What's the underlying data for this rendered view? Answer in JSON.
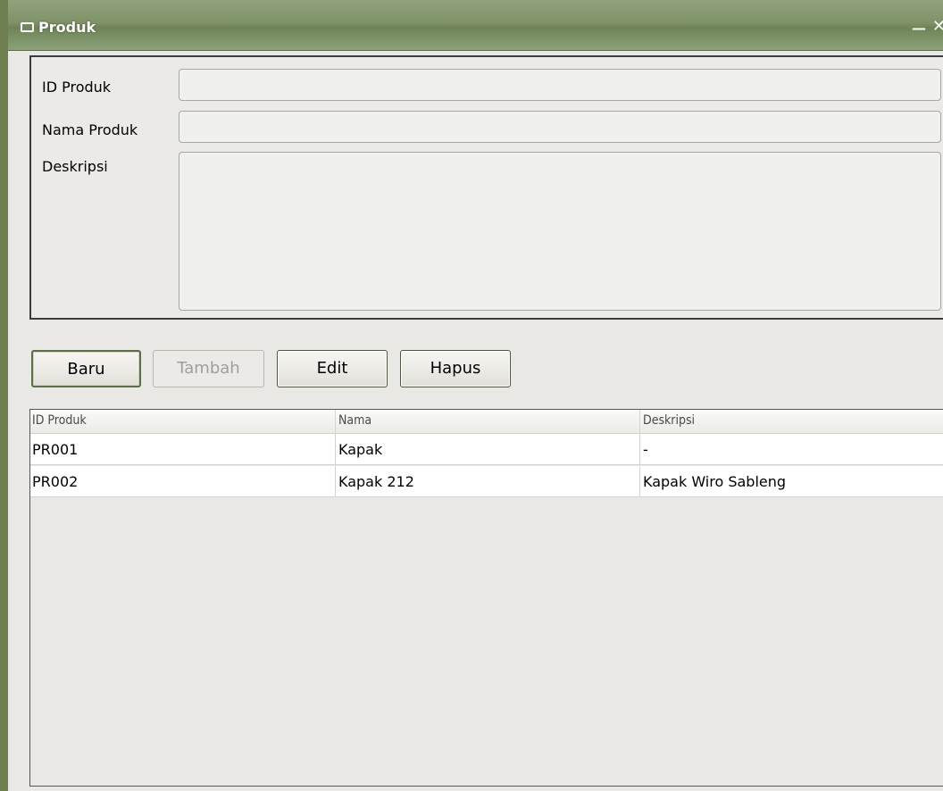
{
  "window": {
    "title": "Produk",
    "minimize_glyph": "—",
    "close_glyph": "✕"
  },
  "form": {
    "id_label": "ID Produk",
    "id_value": "",
    "name_label": "Nama Produk",
    "name_value": "",
    "desc_label": "Deskripsi",
    "desc_value": ""
  },
  "buttons": {
    "new_label": "Baru",
    "add_label": "Tambah",
    "edit_label": "Edit",
    "delete_label": "Hapus"
  },
  "table": {
    "columns": [
      "ID Produk",
      "Nama",
      "Deskripsi"
    ],
    "rows": [
      [
        "PR001",
        "Kapak",
        "-"
      ],
      [
        "PR002",
        "Kapak 212",
        "Kapak Wiro Sableng"
      ]
    ]
  },
  "colors": {
    "titlebar": "#7f9268",
    "window_border": "#6e8050",
    "background": "#e9e8e4"
  }
}
